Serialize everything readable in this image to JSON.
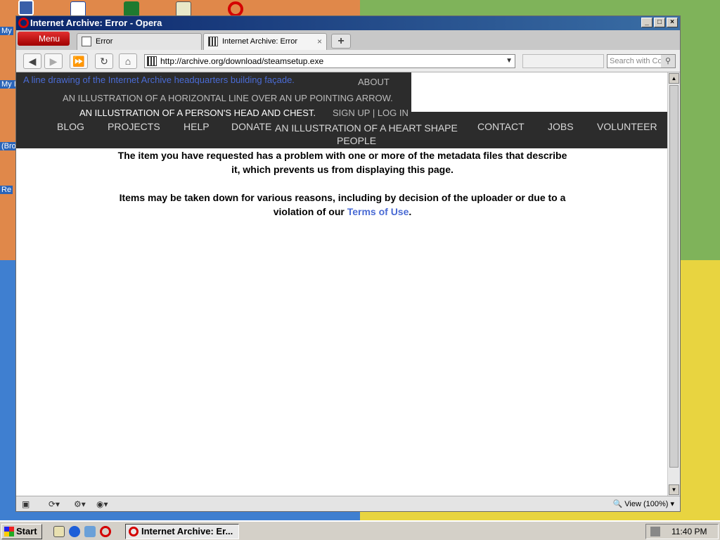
{
  "window": {
    "title": "Internet Archive: Error - Opera",
    "min": "_",
    "max": "□",
    "close": "×"
  },
  "tabs": {
    "menu_label": "Menu",
    "items": [
      {
        "label": "Error"
      },
      {
        "label": "Internet Archive: Error"
      }
    ],
    "new_tab": "+"
  },
  "toolbar": {
    "url": "http://archive.org/download/steamsetup.exe",
    "search_placeholder": "Search with Co"
  },
  "page": {
    "logo_alt": "A line drawing of the Internet Archive headquarters building façade.",
    "about": "ABOUT",
    "arrow_alt": "AN ILLUSTRATION OF A HORIZONTAL LINE OVER AN UP POINTING ARROW.",
    "person_alt": "AN ILLUSTRATION OF A PERSON'S HEAD AND CHEST.",
    "auth": "SIGN UP | LOG IN",
    "nav": {
      "blog": "BLOG",
      "projects": "PROJECTS",
      "help": "HELP",
      "donate": "DONATE",
      "heart_alt": "AN ILLUSTRATION OF A HEART SHAPE",
      "contact": "CONTACT",
      "jobs": "JOBS",
      "volunteer": "VOLUNTEER",
      "people": "PEOPLE"
    },
    "message1_line1": "The item you have requested has a problem with one or more of the metadata files that describe",
    "message1_line2": "it, which prevents us from displaying this page.",
    "message2_line1": "Items may be taken down for various reasons, including by decision of the uploader or due to a",
    "message2_prefix": "violation of our ",
    "terms_link": "Terms of Use",
    "message2_suffix": "."
  },
  "statusbar": {
    "zoom": "View (100%)"
  },
  "taskbar": {
    "start": "Start",
    "task_label": "Internet Archive: Er...",
    "clock": "11:40 PM"
  },
  "desktop": {
    "labels": [
      "My",
      "My I",
      "(Bro",
      "Re"
    ]
  }
}
